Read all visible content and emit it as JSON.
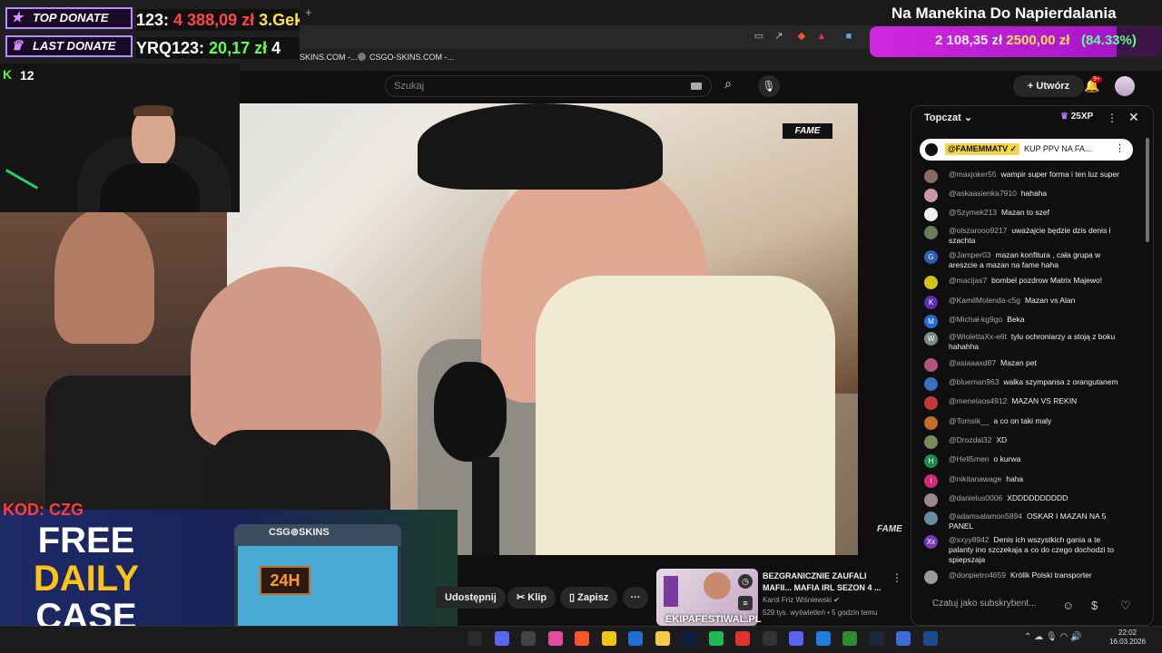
{
  "donate": {
    "top_label": "TOP DONATE",
    "top_value_user": "123: ",
    "top_value_amount": "4 388,09 zł",
    "top_value_next": "  3.Gek",
    "last_label": "LAST DONATE",
    "last_value_user": "YRQ123: ",
    "last_value_amount": "20,17 zł",
    "last_value_next": " 4"
  },
  "goal": {
    "title": "Na Manekina Do Napierdalania",
    "current": "2 108,35 zł",
    "target": "2500,00 zł",
    "percent_label": "(84.33%)",
    "progress": 0.8433,
    "fill_color": "#d128e0"
  },
  "stream_overlay": {
    "viewers": "12",
    "kick_icon": "kick-logo-icon"
  },
  "browser": {
    "bookmarks": [
      "SKINS.COM -...",
      "CSGO-SKINS.COM -..."
    ]
  },
  "youtube": {
    "search_placeholder": "Szukaj",
    "create_label": "Utwórz",
    "notifications_badge": "9+"
  },
  "video": {
    "brand_logo": "FAME",
    "watermark": "FAME"
  },
  "ad": {
    "code": "KOD: CZG",
    "line1": "FREE",
    "line2": "DAILY",
    "line3": "CASE",
    "crate_brand": "CSG⊚SKINS",
    "crate_timer": "24H",
    "accent": "#ffc21a"
  },
  "actions": {
    "share": "Udostępnij",
    "clip": "Klip",
    "save": "Zapisz"
  },
  "suggested": {
    "title": "BEZGRANICZNIE ZAUFALI MAFII... MAFIA IRL SEZON 4 ...",
    "channel": "Karol Friz Wiśniewski",
    "stats": "529 tys. wyświetleń • 5 godzin temu",
    "thumb_text": "EKIPAFESTIWAL.PL"
  },
  "chat": {
    "mode": "Topczat",
    "xp": "25XP",
    "pinned_user": "@FAMEMMATV ✓",
    "pinned_msg": "KUP PPV NA FA...",
    "input_placeholder": "Czatuj jako subskrybent...",
    "messages": [
      {
        "user": "@maxjoker55",
        "text": "wampir super forma i ten luz super",
        "color": "#8a6a6a",
        "initial": ""
      },
      {
        "user": "@askaasienka7910",
        "text": "hahaha",
        "color": "#c79aa5",
        "initial": ""
      },
      {
        "user": "@Szymek213",
        "text": "Mazan to szef",
        "color": "#eeeeee",
        "initial": ""
      },
      {
        "user": "@olszarooo9217",
        "text": "uważajcie będzie dzis denis i szachta",
        "color": "#6a7a5a",
        "initial": ""
      },
      {
        "user": "@Jamper03",
        "text": "mazan konfitura , cała grupa w areszcie a mazan na fame haha",
        "color": "#2d5fb5",
        "initial": "G"
      },
      {
        "user": "@macijas7",
        "text": "bombel pozdrow Matrix Majewo!",
        "color": "#d4c21a",
        "initial": ""
      },
      {
        "user": "@KamilMolenda-c5g",
        "text": "Mazan vs Alan",
        "color": "#5b2fb0",
        "initial": "K"
      },
      {
        "user": "@Michał-kg9go",
        "text": "Beka",
        "color": "#1e6fd6",
        "initial": "M"
      },
      {
        "user": "@WiolettaXx-e6t",
        "text": "tylu ochroniarzy a stoją z boku hahahha",
        "color": "#7a8a8a",
        "initial": "W"
      },
      {
        "user": "@asiaaaxd87",
        "text": "Mazan pet",
        "color": "#b0567a",
        "initial": ""
      },
      {
        "user": "@blueman963",
        "text": "walka szympansa z orangutanem",
        "color": "#3a6fc0",
        "initial": ""
      },
      {
        "user": "@menelaos4912",
        "text": "MAZAN VS REKIN",
        "color": "#c23a3a",
        "initial": ""
      },
      {
        "user": "@Tomsik__",
        "text": "a co on taki maly",
        "color": "#c0702a",
        "initial": ""
      },
      {
        "user": "@Drozdal32",
        "text": "XD",
        "color": "#7a8a5a",
        "initial": ""
      },
      {
        "user": "@Hell5men",
        "text": "o kurwa",
        "color": "#1f8a4a",
        "initial": "H"
      },
      {
        "user": "@nikitanawage",
        "text": "haha",
        "color": "#d42a7a",
        "initial": "I"
      },
      {
        "user": "@danielus0006",
        "text": "XDDDDDDDDDD",
        "color": "#9a8a8a",
        "initial": ""
      },
      {
        "user": "@adamsalamon5894",
        "text": "OSKAR I MAZAN NA 5 PANEL",
        "color": "#6a8aa0",
        "initial": ""
      },
      {
        "user": "@xxyy8942",
        "text": "Denis ich wszystkich gania a te palanty ino szczekaja a co do czego dochodzi to spiepszaja",
        "color": "#7a3ab5",
        "initial": "Xx"
      },
      {
        "user": "@donpietro4659",
        "text": "Królik Polski transporter",
        "color": "#9a9a9a",
        "initial": ""
      }
    ]
  },
  "taskbar": {
    "time": "22:02",
    "date": "16.03.2026"
  }
}
